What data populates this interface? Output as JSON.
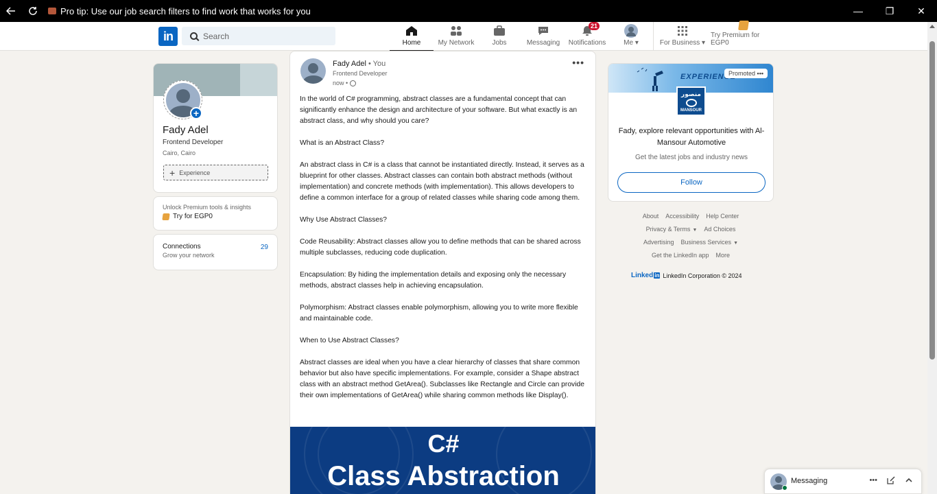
{
  "window": {
    "title": "Pro tip: Use our job search filters to find work that works for you",
    "controls": {
      "minimize": "—",
      "maximize": "❐",
      "close": "✕"
    }
  },
  "nav": {
    "search_placeholder": "Search",
    "items": [
      {
        "label": "Home",
        "icon": "home-icon",
        "active": true
      },
      {
        "label": "My Network",
        "icon": "people-icon"
      },
      {
        "label": "Jobs",
        "icon": "briefcase-icon"
      },
      {
        "label": "Messaging",
        "icon": "chat-icon"
      },
      {
        "label": "Notifications",
        "icon": "bell-icon",
        "badge": "21"
      },
      {
        "label": "Me",
        "icon": "avatar-icon"
      },
      {
        "label": "For Business",
        "icon": "grid-icon"
      },
      {
        "label": "Try Premium for EGP0",
        "icon": "premium-icon"
      }
    ]
  },
  "profile": {
    "name": "Fady Adel",
    "title": "Frontend Developer",
    "location": "Cairo, Cairo",
    "experience_button": "Experience",
    "premium_text": "Unlock Premium tools & insights",
    "premium_link": "Try for EGP0",
    "connections_label": "Connections",
    "connections_sub": "Grow your network",
    "connections_count": "29"
  },
  "post": {
    "author": "Fady Adel",
    "author_suffix": " • You",
    "headline": "Frontend Developer",
    "time": "now •",
    "paragraphs": [
      "In the world of C# programming, abstract classes are a fundamental concept that can significantly enhance the design and architecture of your software. But what exactly is an abstract class, and why should you care?",
      "What is an Abstract Class?",
      "An abstract class in C# is a class that cannot be instantiated directly. Instead, it serves as a blueprint for other classes. Abstract classes can contain both abstract methods (without implementation) and concrete methods (with implementation). This allows developers to define a common interface for a group of related classes while sharing code among them.",
      "Why Use Abstract Classes?",
      "Code Reusability: Abstract classes allow you to define methods that can be shared across multiple subclasses, reducing code duplication.",
      "Encapsulation: By hiding the implementation details and exposing only the necessary methods, abstract classes help in achieving encapsulation.",
      "Polymorphism: Abstract classes enable polymorphism, allowing you to write more flexible and maintainable code.",
      "When to Use Abstract Classes?",
      "Abstract classes are ideal when you have a clear hierarchy of classes that share common behavior but also have specific implementations. For example, consider a Shape abstract class with an abstract method GetArea(). Subclasses like Rectangle and Circle can provide their own implementations of GetArea() while sharing common methods like Display()."
    ],
    "image_line1": "C#",
    "image_line2": "Class Abstraction"
  },
  "ad": {
    "promoted": "Promoted",
    "banner_text": "EXPERIENCE",
    "logo_ar": "منصور",
    "logo_en": "MANSOUR",
    "headline": "Fady, explore relevant opportunities with Al-Mansour Automotive",
    "description": "Get the latest jobs and industry news",
    "follow": "Follow"
  },
  "footer": {
    "row1": [
      "About",
      "Accessibility",
      "Help Center"
    ],
    "row2": [
      "Privacy & Terms",
      "Ad Choices"
    ],
    "row3": [
      "Advertising",
      "Business Services"
    ],
    "row4": [
      "Get the LinkedIn app",
      "More"
    ],
    "brand": "Linked",
    "brand_box": "in",
    "corp": "LinkedIn Corporation © 2024"
  },
  "messaging": {
    "label": "Messaging"
  },
  "colors": {
    "brand": "#0a66c2",
    "badge": "#cb112d",
    "background": "#f4f2ee"
  }
}
